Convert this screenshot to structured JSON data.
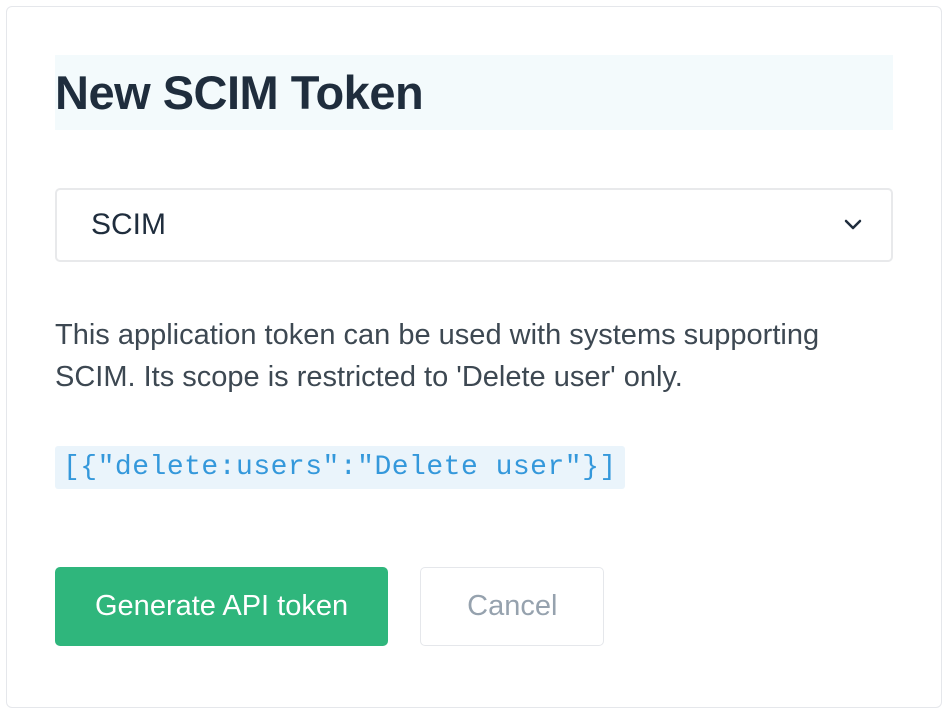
{
  "header": {
    "title": "New SCIM Token"
  },
  "form": {
    "token_type_selected": "SCIM",
    "description": "This application token can be used with systems supporting SCIM. Its scope is restricted to 'Delete user' only.",
    "scope_code": "[{\"delete:users\":\"Delete user\"}]"
  },
  "actions": {
    "generate_label": "Generate API token",
    "cancel_label": "Cancel"
  }
}
